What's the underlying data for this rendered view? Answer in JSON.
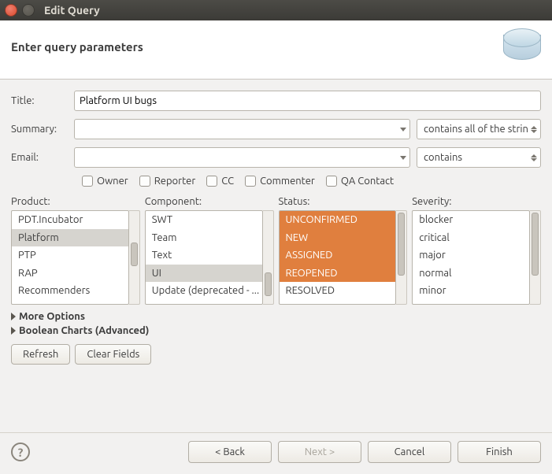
{
  "window": {
    "title": "Edit Query"
  },
  "banner": {
    "heading": "Enter query parameters"
  },
  "fields": {
    "title_label": "Title:",
    "title_value": "Platform UI bugs",
    "summary_label": "Summary:",
    "summary_value": "",
    "summary_mode": "contains all of the strin",
    "email_label": "Email:",
    "email_value": "",
    "email_mode": "contains"
  },
  "email_checks": {
    "owner": "Owner",
    "reporter": "Reporter",
    "cc": "CC",
    "commenter": "Commenter",
    "qa": "QA Contact"
  },
  "lists": {
    "product": {
      "label": "Product:",
      "items": [
        "PDT.Incubator",
        "Platform",
        "PTP",
        "RAP",
        "Recommenders"
      ],
      "selected": [
        "Platform"
      ]
    },
    "component": {
      "label": "Component:",
      "items": [
        "SWT",
        "Team",
        "Text",
        "UI",
        "Update (deprecated - ..."
      ],
      "selected": [
        "UI"
      ]
    },
    "status": {
      "label": "Status:",
      "items": [
        "UNCONFIRMED",
        "NEW",
        "ASSIGNED",
        "REOPENED",
        "RESOLVED"
      ],
      "selected": [
        "UNCONFIRMED",
        "NEW",
        "ASSIGNED",
        "REOPENED"
      ]
    },
    "severity": {
      "label": "Severity:",
      "items": [
        "blocker",
        "critical",
        "major",
        "normal",
        "minor"
      ],
      "selected": []
    }
  },
  "expanders": {
    "more": "More Options",
    "bool": "Boolean Charts (Advanced)"
  },
  "actions": {
    "refresh": "Refresh",
    "clear": "Clear Fields"
  },
  "footer": {
    "back": "< Back",
    "next": "Next >",
    "cancel": "Cancel",
    "finish": "Finish"
  }
}
